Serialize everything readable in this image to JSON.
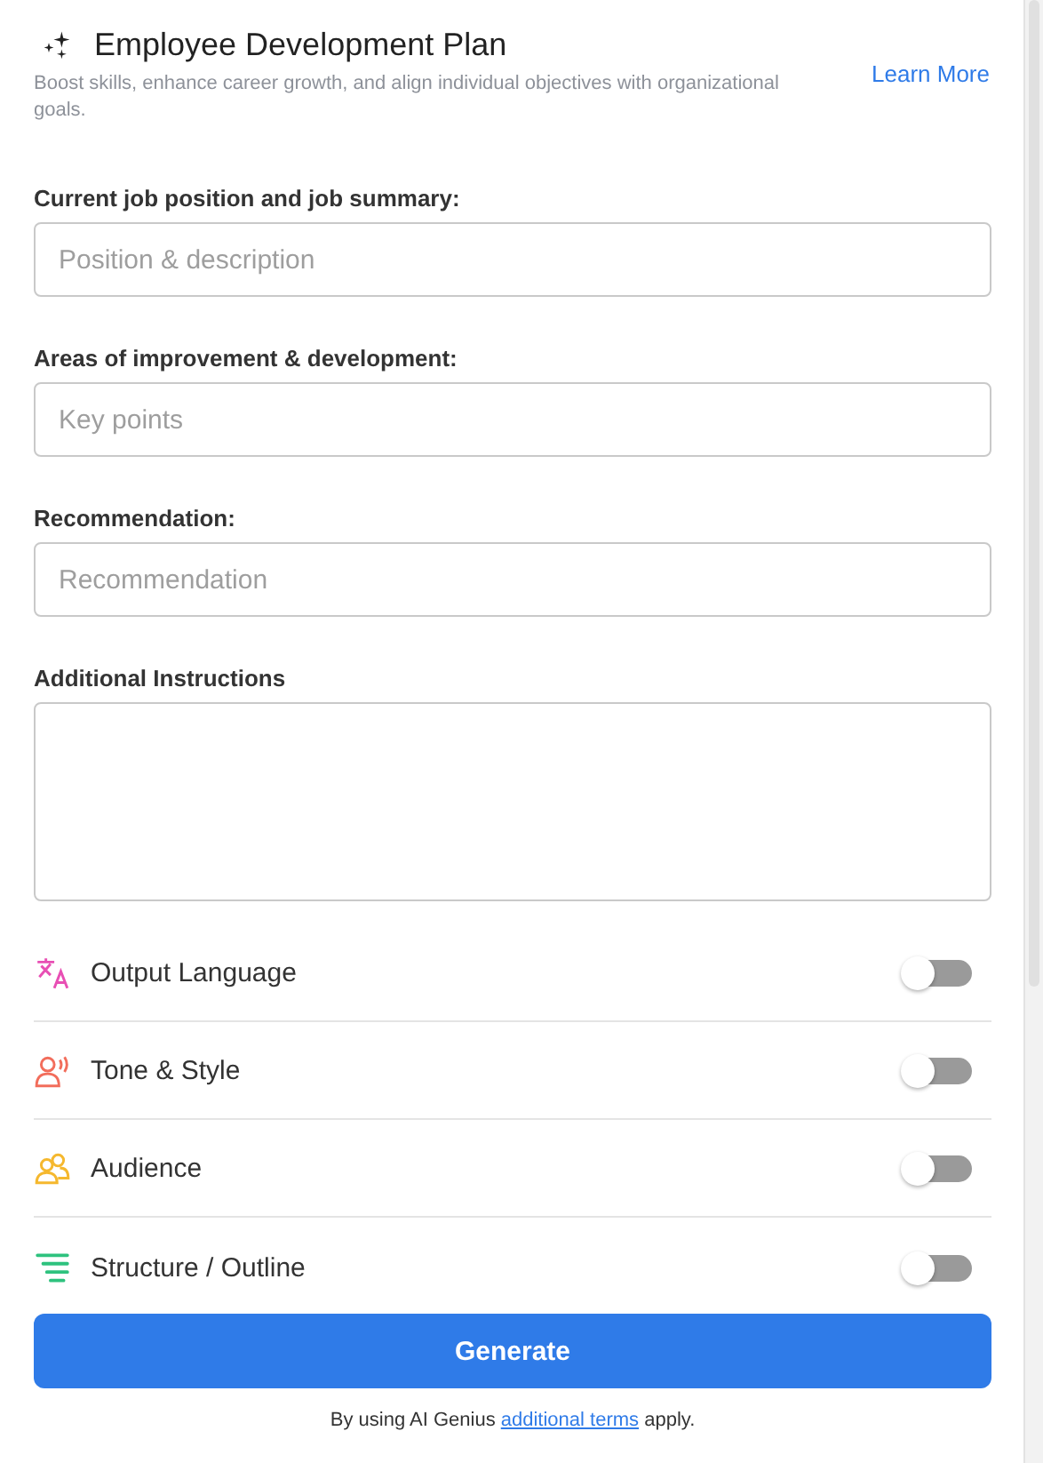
{
  "header": {
    "title": "Employee Development Plan",
    "subtitle": "Boost skills, enhance career growth, and align individual objectives with organizational goals.",
    "link": "Learn More"
  },
  "fields": [
    {
      "kind": "input",
      "label": "Current job position and job summary:",
      "placeholder": "Position & description"
    },
    {
      "kind": "input",
      "label": "Areas of improvement & development:",
      "placeholder": "Key points"
    },
    {
      "kind": "input",
      "label": "Recommendation:",
      "placeholder": "Recommendation"
    },
    {
      "kind": "textarea",
      "label": "Additional Instructions"
    }
  ],
  "options": [
    {
      "kind": "language",
      "label": "Output Language",
      "color": "#e84fb4",
      "on": false
    },
    {
      "kind": "tone",
      "label": "Tone & Style",
      "color": "#f26d5b",
      "on": false
    },
    {
      "kind": "audience",
      "label": "Audience",
      "color": "#f5b82e",
      "on": false
    },
    {
      "kind": "structure",
      "label": "Structure / Outline",
      "color": "#2ec27e",
      "on": false
    }
  ],
  "button": "Generate",
  "footer": {
    "before": "By using AI Genius",
    "link": "additional terms",
    "after": "apply."
  }
}
